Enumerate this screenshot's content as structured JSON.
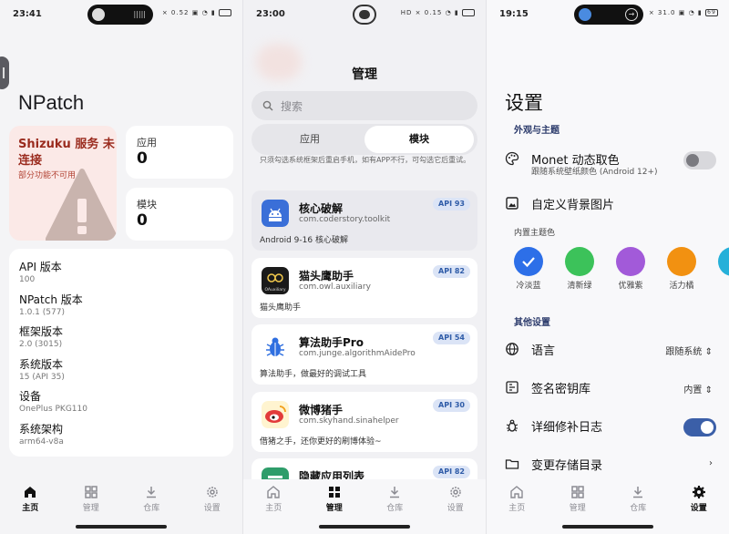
{
  "panel1": {
    "time": "23:41",
    "status_icons": "0.52",
    "battery": "",
    "app_name": "NPatch",
    "status_title": "Shizuku 服务 未连接",
    "status_subtitle": "部分功能不可用",
    "apps_label": "应用",
    "apps_count": "0",
    "modules_label": "模块",
    "modules_count": "0",
    "info": [
      {
        "key": "API 版本",
        "value": "100"
      },
      {
        "key": "NPatch 版本",
        "value": "1.0.1 (577)"
      },
      {
        "key": "框架版本",
        "value": "2.0 (3015)"
      },
      {
        "key": "系统版本",
        "value": "15 (API 35)"
      },
      {
        "key": "设备",
        "value": "OnePlus PKG110"
      },
      {
        "key": "系统架构",
        "value": "arm64-v8a"
      }
    ],
    "nav": [
      {
        "label": "主页",
        "icon": "home-icon",
        "active": true
      },
      {
        "label": "管理",
        "icon": "grid-icon",
        "active": false
      },
      {
        "label": "仓库",
        "icon": "download-icon",
        "active": false
      },
      {
        "label": "设置",
        "icon": "gear-icon",
        "active": false
      }
    ]
  },
  "panel2": {
    "time": "23:00",
    "status_icons": "0.15",
    "title": "管理",
    "search_placeholder": "搜索",
    "tabs": [
      "应用",
      "模块"
    ],
    "active_tab": "模块",
    "cutoff_text": "只须勾选系统框架后重启手机，如有APP不行，可勾选它后重试。",
    "modules": [
      {
        "name": "核心破解",
        "pkg": "com.coderstory.toolkit",
        "desc": "Android 9-16 核心破解",
        "api": "API 93",
        "icon_color": "#3a6fd8",
        "icon": "android-icon"
      },
      {
        "name": "猫头鹰助手",
        "pkg": "com.owl.auxiliary",
        "desc": "猫头鹰助手",
        "api": "API 82",
        "icon_color": "#1a1a1a",
        "icon": "owl-icon",
        "icon_text": "OAuxiliary"
      },
      {
        "name": "算法助手Pro",
        "pkg": "com.junge.algorithmAidePro",
        "desc": "算法助手，做最好的调试工具",
        "api": "API 54",
        "icon_color": "#2f6fe0",
        "icon": "bug-icon"
      },
      {
        "name": "微博猪手",
        "pkg": "com.skyhand.sinahelper",
        "desc": "借猪之手，还你更好的刷博体验~",
        "api": "API 30",
        "icon_color": "#f2c94c",
        "icon": "weibo-icon"
      },
      {
        "name": "隐藏应用列表",
        "pkg": "",
        "desc": "",
        "api": "API 82",
        "icon_color": "#2e9d6a",
        "icon": "hide-icon"
      }
    ],
    "nav": [
      {
        "label": "主页",
        "icon": "home-icon",
        "active": false
      },
      {
        "label": "管理",
        "icon": "grid-icon",
        "active": true
      },
      {
        "label": "仓库",
        "icon": "download-icon",
        "active": false
      },
      {
        "label": "设置",
        "icon": "gear-icon",
        "active": false
      }
    ]
  },
  "panel3": {
    "time": "19:15",
    "status_icons": "31.0",
    "battery": "69",
    "title": "设置",
    "section_appearance": "外观与主题",
    "monet_title": "Monet 动态取色",
    "monet_sub": "跟随系统壁纸颜色 (Android 12+)",
    "custom_bg": "自定义背景图片",
    "builtin_colors_label": "内置主题色",
    "colors": [
      {
        "name": "冷淡蓝",
        "hex": "#2d6fe8",
        "selected": true
      },
      {
        "name": "清新绿",
        "hex": "#3cc25a",
        "selected": false
      },
      {
        "name": "优雅紫",
        "hex": "#a25ad9",
        "selected": false
      },
      {
        "name": "活力橘",
        "hex": "#f29111",
        "selected": false
      }
    ],
    "section_other": "其他设置",
    "language": "语言",
    "language_value": "跟随系统",
    "keystore": "签名密钥库",
    "keystore_value": "内置",
    "verbose_log": "详细修补日志",
    "storage_dir": "变更存储目录",
    "nav": [
      {
        "label": "主页",
        "icon": "home-icon",
        "active": false
      },
      {
        "label": "管理",
        "icon": "grid-icon",
        "active": false
      },
      {
        "label": "仓库",
        "icon": "download-icon",
        "active": false
      },
      {
        "label": "设置",
        "icon": "gear-icon",
        "active": true
      }
    ]
  }
}
